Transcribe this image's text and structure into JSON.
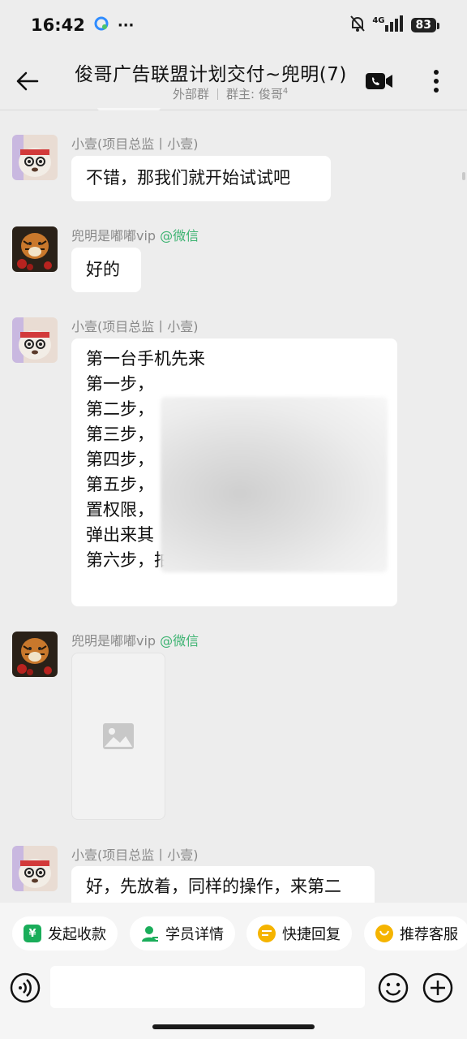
{
  "status_bar": {
    "time": "16:42",
    "more": "···",
    "network": "4G",
    "battery": "83"
  },
  "header": {
    "title": "俊哥广告联盟计划交付~兜明(7)",
    "group_type": "外部群",
    "owner_label": "群主: 俊哥",
    "owner_sup": "4"
  },
  "messages": [
    {
      "sender": "小壹(项目总监丨小壹)",
      "lines": [
        "不错，那我们就开始试试吧"
      ]
    },
    {
      "sender": "兜明是嘟嘟vip",
      "tag": "@微信",
      "lines": [
        "好的"
      ]
    },
    {
      "sender": "小壹(项目总监丨小壹)",
      "lines": [
        "第一台手机先来",
        "",
        "第一步，",
        "第二步，",
        "第三步，",
        "第四步，",
        "第五步，",
        "置权限，",
        "弹出来其",
        "第六步，拍照过来"
      ]
    },
    {
      "sender": "兜明是嘟嘟vip",
      "tag": "@微信",
      "lines": []
    },
    {
      "sender": "小壹(项目总监丨小壹)",
      "lines": [
        "好，先放着，同样的操作，来第二"
      ]
    }
  ],
  "quick_actions": [
    {
      "label": "发起收款",
      "icon": "yuan-icon",
      "color": "#1aad5a"
    },
    {
      "label": "学员详情",
      "icon": "person-icon",
      "color": "#1aad5a"
    },
    {
      "label": "快捷回复",
      "icon": "reply-icon",
      "color": "#f5b400"
    },
    {
      "label": "推荐客服",
      "icon": "service-icon",
      "color": "#f5b400"
    }
  ],
  "input": {
    "placeholder": ""
  }
}
